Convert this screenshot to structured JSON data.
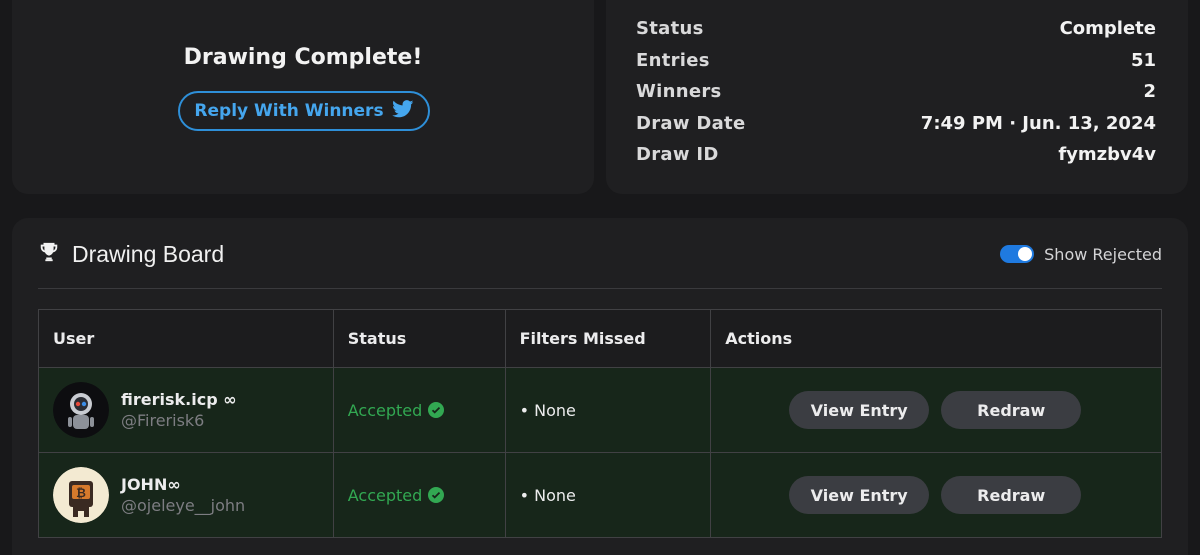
{
  "summary": {
    "title": "Drawing Complete!",
    "reply_button_label": "Reply With Winners"
  },
  "stats": [
    {
      "label": "Status",
      "value": "Complete"
    },
    {
      "label": "Entries",
      "value": "51"
    },
    {
      "label": "Winners",
      "value": "2"
    },
    {
      "label": "Draw Date",
      "value": "7:49 PM · Jun. 13, 2024"
    },
    {
      "label": "Draw ID",
      "value": "fymzbv4v"
    }
  ],
  "board": {
    "title": "Drawing Board",
    "show_rejected_label": "Show Rejected",
    "show_rejected_on": true,
    "columns": [
      "User",
      "Status",
      "Filters Missed",
      "Actions"
    ],
    "rows": [
      {
        "name": "firerisk.icp ∞",
        "handle": "@Firerisk6",
        "status": "Accepted",
        "filters_missed": "• None",
        "view_label": "View Entry",
        "redraw_label": "Redraw"
      },
      {
        "name": "JOHN∞",
        "handle": "@ojeleye__john",
        "status": "Accepted",
        "filters_missed": "• None",
        "view_label": "View Entry",
        "redraw_label": "Redraw"
      }
    ]
  },
  "colors": {
    "accent_blue": "#2e8fd8",
    "accepted_green": "#32a852",
    "toggle_blue": "#1f7ae0"
  }
}
